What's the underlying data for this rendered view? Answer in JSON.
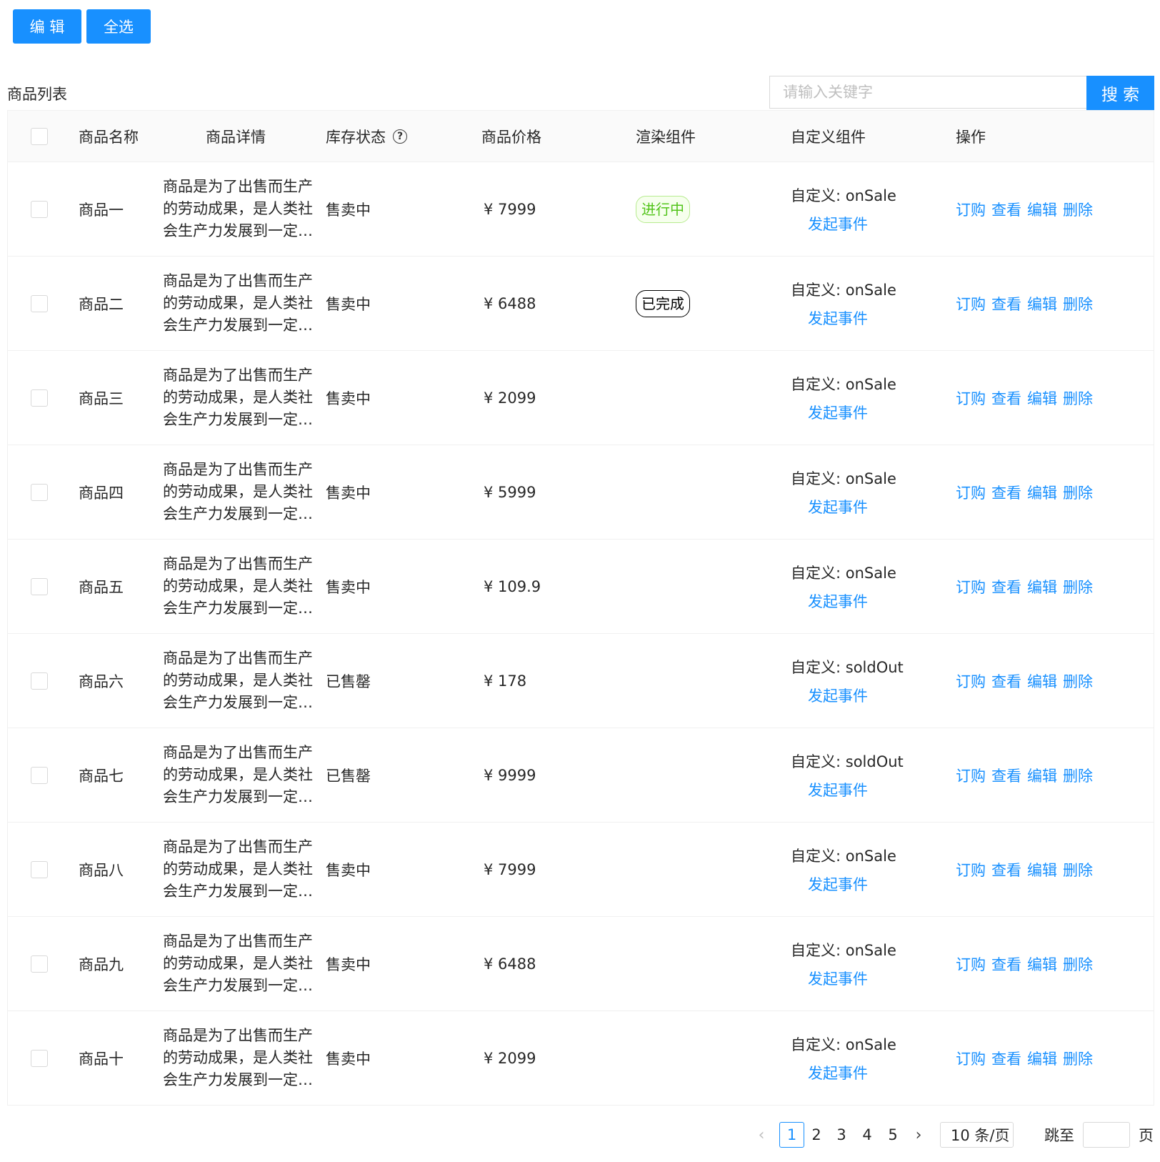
{
  "toolbar": {
    "edit_label": "编 辑",
    "select_all_label": "全选"
  },
  "list": {
    "title": "商品列表",
    "search_placeholder": "请输入关键字",
    "search_label": "搜 索"
  },
  "table": {
    "headers": {
      "name": "商品名称",
      "detail": "商品详情",
      "stock": "库存状态",
      "price": "商品价格",
      "render": "渲染组件",
      "custom": "自定义组件",
      "ops": "操作"
    },
    "stock_help_icon": "question-circle-icon",
    "event_label": "发起事件",
    "ops_labels": {
      "order": "订购",
      "view": "查看",
      "edit": "编辑",
      "delete": "删除"
    },
    "rows": [
      {
        "name": "商品一",
        "detail": "商品是为了出售而生产的劳动成果，是人类社会生产力发展到一定历史阶段的产物",
        "stock": "售卖中",
        "price": "¥ 7999",
        "tag": "进行中",
        "tag_style": "green",
        "custom": "自定义: onSale"
      },
      {
        "name": "商品二",
        "detail": "商品是为了出售而生产的劳动成果，是人类社会生产力发展到一定历史阶段的产物",
        "stock": "售卖中",
        "price": "¥ 6488",
        "tag": "已完成",
        "tag_style": "dark",
        "custom": "自定义: onSale"
      },
      {
        "name": "商品三",
        "detail": "商品是为了出售而生产的劳动成果，是人类社会生产力发展到一定历史阶段的产物",
        "stock": "售卖中",
        "price": "¥ 2099",
        "tag": "",
        "tag_style": "",
        "custom": "自定义: onSale"
      },
      {
        "name": "商品四",
        "detail": "商品是为了出售而生产的劳动成果，是人类社会生产力发展到一定历史阶段的产物",
        "stock": "售卖中",
        "price": "¥ 5999",
        "tag": "",
        "tag_style": "",
        "custom": "自定义: onSale"
      },
      {
        "name": "商品五",
        "detail": "商品是为了出售而生产的劳动成果，是人类社会生产力发展到一定历史阶段的产物",
        "stock": "售卖中",
        "price": "¥ 109.9",
        "tag": "",
        "tag_style": "",
        "custom": "自定义: onSale"
      },
      {
        "name": "商品六",
        "detail": "商品是为了出售而生产的劳动成果，是人类社会生产力发展到一定历史阶段的产物",
        "stock": "已售罄",
        "price": "¥ 178",
        "tag": "",
        "tag_style": "",
        "custom": "自定义: soldOut"
      },
      {
        "name": "商品七",
        "detail": "商品是为了出售而生产的劳动成果，是人类社会生产力发展到一定历史阶段的产物",
        "stock": "已售罄",
        "price": "¥ 9999",
        "tag": "",
        "tag_style": "",
        "custom": "自定义: soldOut"
      },
      {
        "name": "商品八",
        "detail": "商品是为了出售而生产的劳动成果，是人类社会生产力发展到一定历史阶段的产物",
        "stock": "售卖中",
        "price": "¥ 7999",
        "tag": "",
        "tag_style": "",
        "custom": "自定义: onSale"
      },
      {
        "name": "商品九",
        "detail": "商品是为了出售而生产的劳动成果，是人类社会生产力发展到一定历史阶段的产物",
        "stock": "售卖中",
        "price": "¥ 6488",
        "tag": "",
        "tag_style": "",
        "custom": "自定义: onSale"
      },
      {
        "name": "商品十",
        "detail": "商品是为了出售而生产的劳动成果，是人类社会生产力发展到一定历史阶段的产物",
        "stock": "售卖中",
        "price": "¥ 2099",
        "tag": "",
        "tag_style": "",
        "custom": "自定义: onSale"
      }
    ]
  },
  "pagination": {
    "prev_icon": "chevron-left-icon",
    "next_icon": "chevron-right-icon",
    "pages": [
      "1",
      "2",
      "3",
      "4",
      "5"
    ],
    "current": "1",
    "page_size": "10 条/页",
    "jump_label": "跳至",
    "page_label": "页"
  },
  "colors": {
    "primary": "#1890ff",
    "tag_green": "#52c41a",
    "border": "#f0f0f0",
    "header_bg": "#fafafa"
  }
}
